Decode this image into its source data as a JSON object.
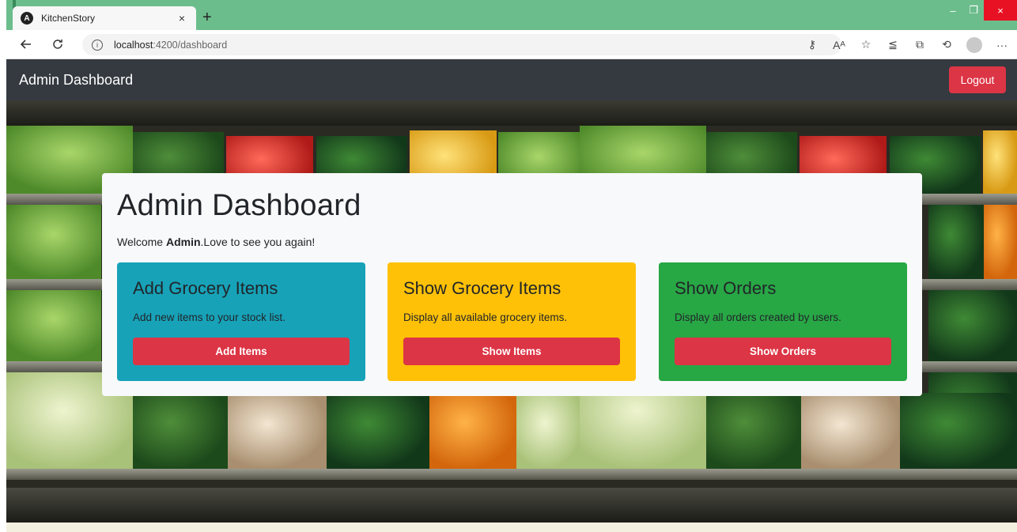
{
  "browser": {
    "tab_title": "KitchenStory",
    "tab_close": "×",
    "new_tab": "+",
    "url_host": "localhost",
    "url_path": ":4200/dashboard",
    "window_controls": {
      "minimize": "–",
      "restore": "❐",
      "close": "×"
    },
    "nav_icons": [
      "back-icon",
      "refresh-icon"
    ],
    "toolbar_icons": [
      "key-icon",
      "read-aloud-icon",
      "favorite-icon",
      "favorites-list-icon",
      "collections-icon",
      "history-icon",
      "profile-avatar-icon",
      "more-icon"
    ]
  },
  "navbar": {
    "brand": "Admin Dashboard",
    "logout_label": "Logout"
  },
  "dashboard": {
    "title": "Admin Dashboard",
    "welcome_prefix": "Welcome ",
    "welcome_name": "Admin",
    "welcome_suffix": ".Love to see you again!",
    "cards": [
      {
        "title": "Add Grocery Items",
        "text": "Add new items to your stock list.",
        "button": "Add Items",
        "color": "#17a2b8"
      },
      {
        "title": "Show Grocery Items",
        "text": "Display all available grocery items.",
        "button": "Show Items",
        "color": "#ffc107"
      },
      {
        "title": "Show Orders",
        "text": "Display all orders created by users.",
        "button": "Show Orders",
        "color": "#28a745"
      }
    ]
  },
  "colors": {
    "navbar_bg": "#343a40",
    "danger": "#dc3545",
    "tab_strip": "#6cbd8c"
  }
}
